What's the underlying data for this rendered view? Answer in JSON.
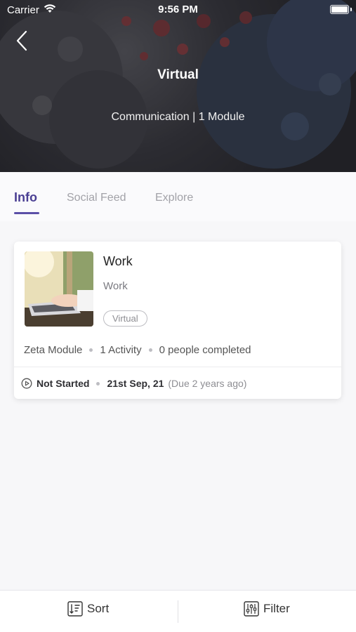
{
  "status_bar": {
    "carrier": "Carrier",
    "time": "9:56 PM"
  },
  "header": {
    "title": "Virtual",
    "subtitle": "Communication | 1 Module"
  },
  "tabs": [
    {
      "label": "Info",
      "active": true
    },
    {
      "label": "Social Feed",
      "active": false
    },
    {
      "label": "Explore",
      "active": false
    }
  ],
  "card": {
    "title": "Work",
    "subtitle": "Work",
    "badge": "Virtual",
    "meta": {
      "module": "Zeta Module",
      "activity": "1 Activity",
      "completed": "0 people completed"
    },
    "status": {
      "state": "Not Started",
      "date": "21st Sep, 21",
      "due": "(Due 2 years ago)"
    }
  },
  "bottom_bar": {
    "sort_label": "Sort",
    "filter_label": "Filter"
  },
  "colors": {
    "accent": "#5b4fa7",
    "tab_inactive": "#a2a2a8"
  }
}
